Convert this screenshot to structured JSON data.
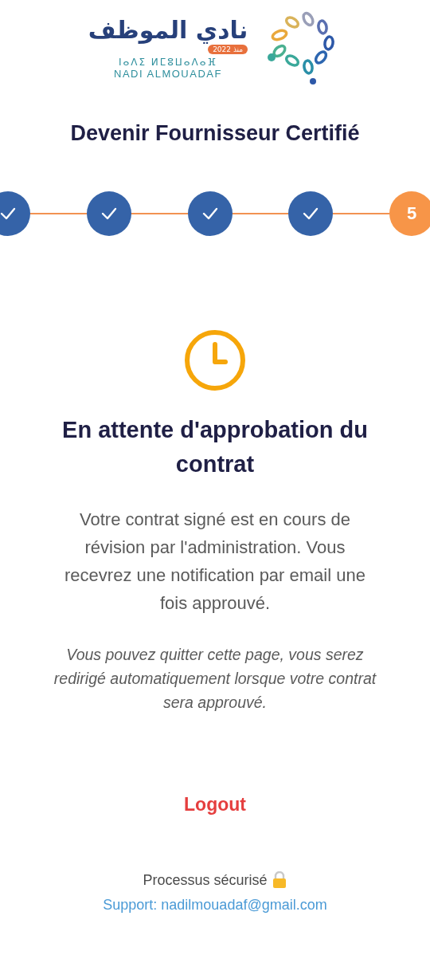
{
  "logo": {
    "arabic_name": "نادي الموظف",
    "since": "منذ 2022",
    "tifinagh": "ⵏⴰⴷⵉ ⵍⵎⵓⵡⴰⴷⴰⴼ",
    "latin_name": "NADI ALMOUADAF"
  },
  "title": "Devenir Fournisseur Certifié",
  "steps": [
    {
      "kind": "done"
    },
    {
      "kind": "done"
    },
    {
      "kind": "done"
    },
    {
      "kind": "done"
    },
    {
      "kind": "current",
      "label": "5"
    }
  ],
  "status": {
    "heading": "En attente d'approbation du contrat",
    "message": "Votre contrat signé est en cours de révision par l'administration. Vous recevrez une notification par email une fois approuvé.",
    "note": "Vous pouvez quitter cette page, vous serez redirigé automatiquement lorsque votre contrat sera approuvé."
  },
  "logout": "Logout",
  "footer": {
    "secure": "Processus sécurisé",
    "support": "Support: nadilmouadaf@gmail.com"
  }
}
